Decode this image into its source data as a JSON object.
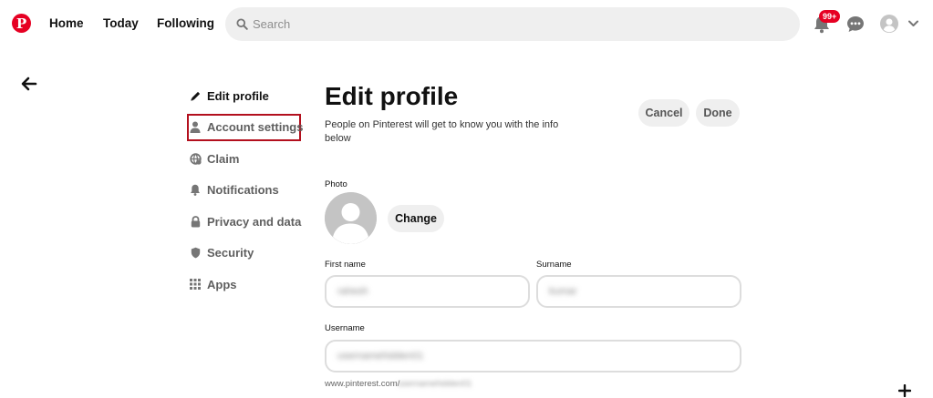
{
  "colors": {
    "brand": "#e60023",
    "highlight": "#b3101e"
  },
  "header": {
    "logo_letter": "P",
    "nav": [
      "Home",
      "Today",
      "Following"
    ],
    "search": {
      "placeholder": "Search",
      "value": ""
    },
    "notification_badge": "99+",
    "icons": [
      "pinterest-logo",
      "search-icon",
      "bell-icon",
      "chat-icon",
      "user-avatar-icon",
      "chevron-down-icon"
    ]
  },
  "sidebar": {
    "items": [
      {
        "label": "Edit profile",
        "icon": "pencil-icon",
        "active": true
      },
      {
        "label": "Account settings",
        "icon": "person-icon",
        "highlighted": true
      },
      {
        "label": "Claim",
        "icon": "claim-icon"
      },
      {
        "label": "Notifications",
        "icon": "bell-icon"
      },
      {
        "label": "Privacy and data",
        "icon": "lock-icon"
      },
      {
        "label": "Security",
        "icon": "shield-icon"
      },
      {
        "label": "Apps",
        "icon": "grid-icon"
      }
    ]
  },
  "main": {
    "title": "Edit profile",
    "subtitle": "People on Pinterest will get to know you with the info below",
    "buttons": {
      "cancel": "Cancel",
      "done": "Done"
    },
    "photo": {
      "label": "Photo",
      "change": "Change"
    },
    "first_name": {
      "label": "First name",
      "value": "rahesh"
    },
    "surname": {
      "label": "Surname",
      "value": "kumar"
    },
    "username": {
      "label": "Username",
      "value": "usernamehidden01"
    },
    "url_prefix": "www.pinterest.com/",
    "url_suffix": "usernamehidden01"
  }
}
